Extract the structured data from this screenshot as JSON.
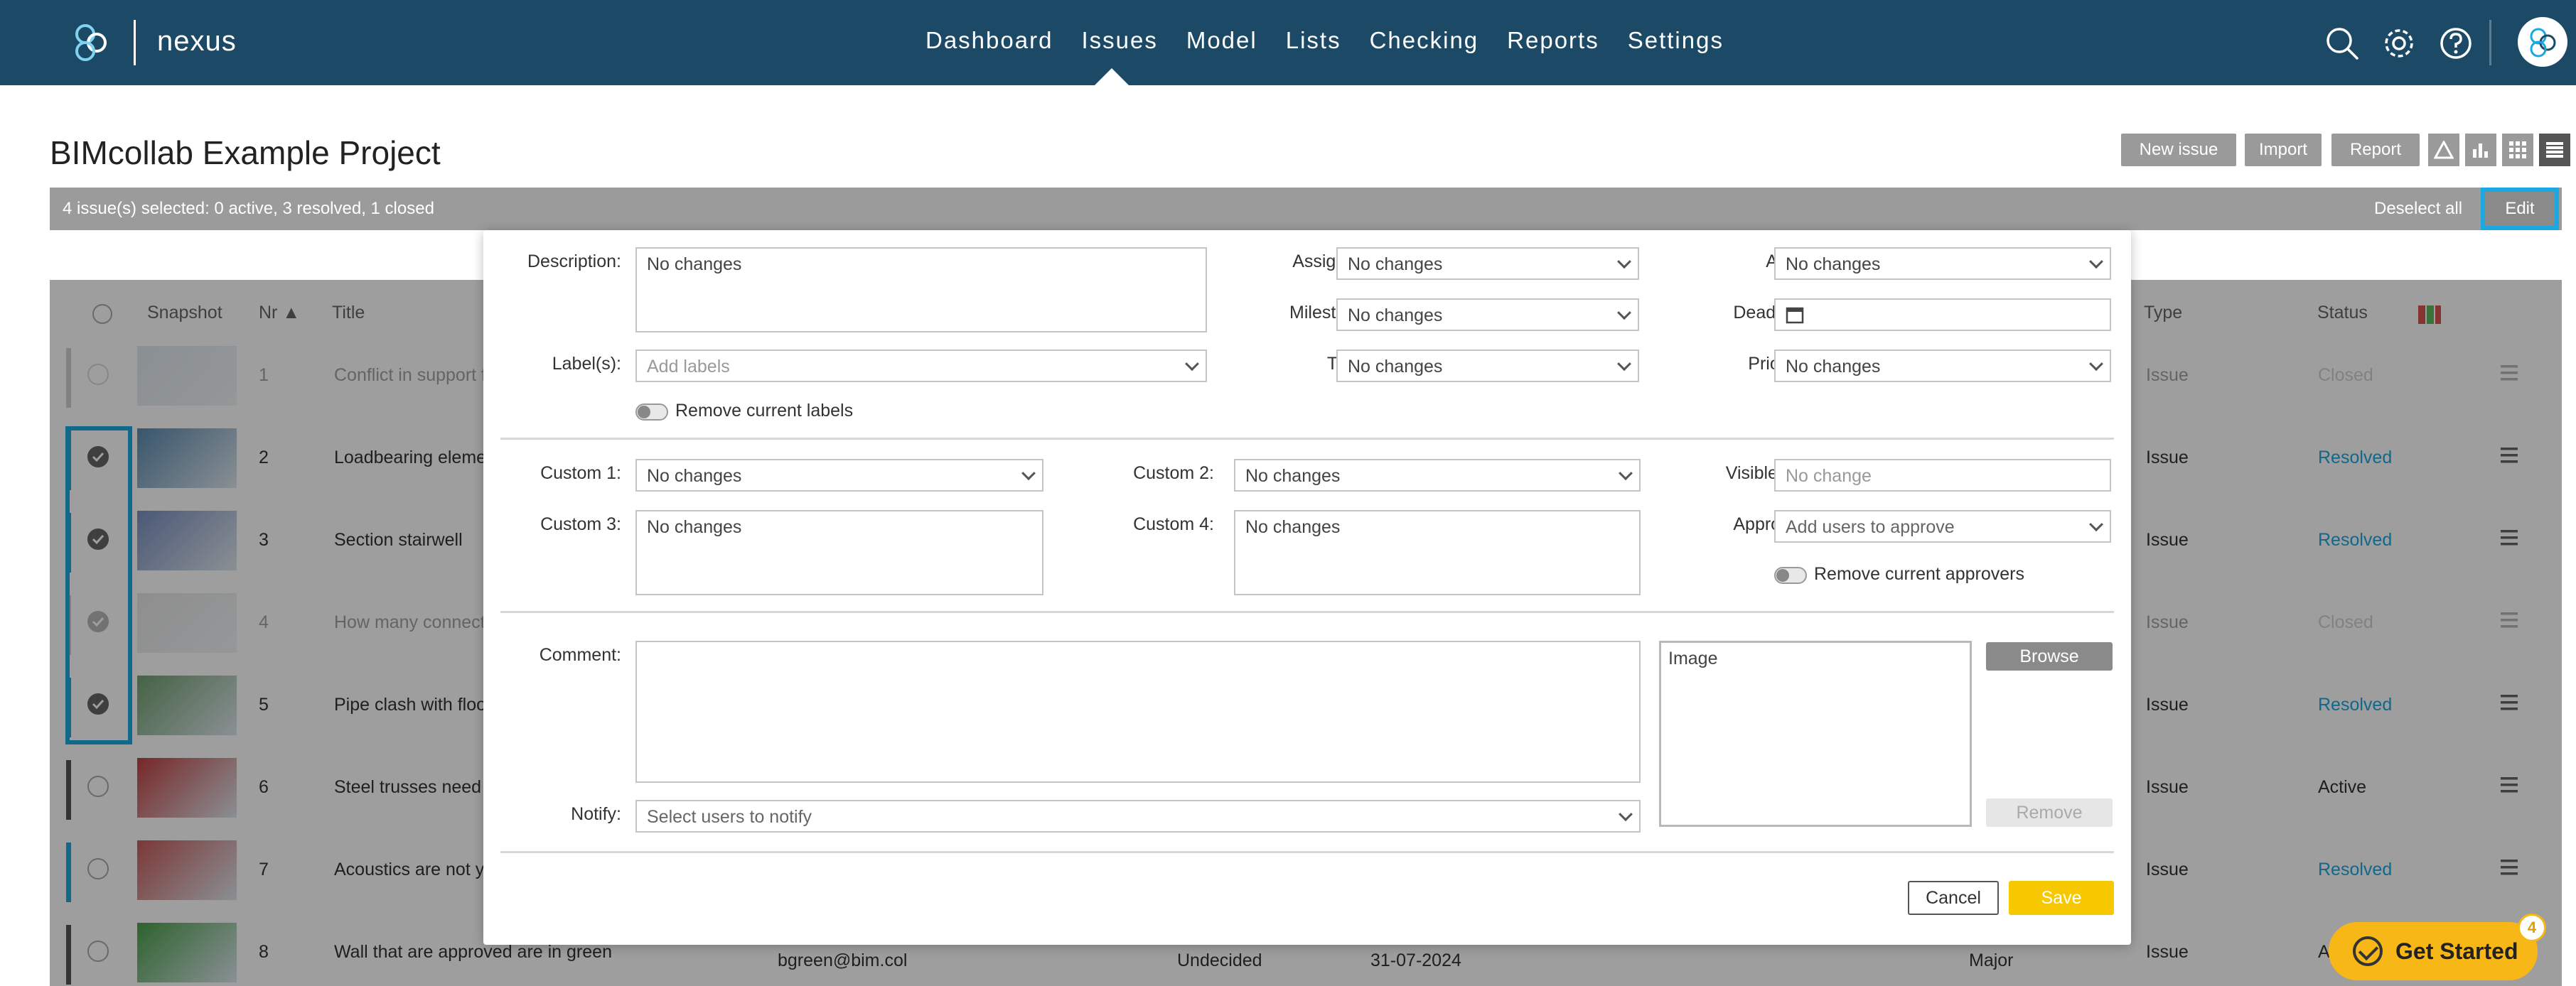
{
  "app": {
    "brand": "nexus"
  },
  "nav": {
    "items": [
      "Dashboard",
      "Issues",
      "Model",
      "Lists",
      "Checking",
      "Reports",
      "Settings"
    ],
    "active": "Issues"
  },
  "header": {
    "project_title": "BIMcollab Example Project",
    "buttons": {
      "new_issue": "New issue",
      "import": "Import",
      "report": "Report"
    }
  },
  "selection": {
    "summary": "4 issue(s) selected: 0 active, 3 resolved, 1 closed",
    "deselect_all": "Deselect all",
    "edit": "Edit"
  },
  "table": {
    "headers": {
      "snapshot": "Snapshot",
      "nr": "Nr ▲",
      "title": "Title",
      "type": "Type",
      "status": "Status"
    },
    "rows": [
      {
        "nr": "1",
        "title": "Conflict in support f",
        "type": "Issue",
        "status": "Closed",
        "checked": false,
        "strip": "#999999",
        "dim": true
      },
      {
        "nr": "2",
        "title": "Loadbearing eleme",
        "type": "Issue",
        "status": "Resolved",
        "checked": true,
        "strip": "#1ba8e0",
        "dim": false
      },
      {
        "nr": "3",
        "title": "Section stairwell",
        "type": "Issue",
        "status": "Resolved",
        "checked": true,
        "strip": "#1ba8e0",
        "dim": false
      },
      {
        "nr": "4",
        "title": "How many connecti",
        "type": "Issue",
        "status": "Closed",
        "checked": true,
        "strip": "#999999",
        "dim": true
      },
      {
        "nr": "5",
        "title": "Pipe clash with floo",
        "type": "Issue",
        "status": "Resolved",
        "checked": true,
        "strip": "#1ba8e0",
        "dim": false
      },
      {
        "nr": "6",
        "title": "Steel trusses need",
        "type": "Issue",
        "status": "Active",
        "checked": false,
        "strip": "#555555",
        "dim": false
      },
      {
        "nr": "7",
        "title": "Acoustics are not yo",
        "type": "Issue",
        "status": "Resolved",
        "checked": false,
        "strip": "#1ba8e0",
        "dim": false
      },
      {
        "nr": "8",
        "title": "Wall that are approved are in green",
        "type": "Issue",
        "status": "A",
        "checked": false,
        "strip": "#555555",
        "dim": false,
        "assigned": "bgreen@bim.col",
        "milestone": "Undecided",
        "deadline": "31-07-2024",
        "priority": "Major"
      }
    ]
  },
  "dialog": {
    "labels": {
      "description": "Description:",
      "labels": "Label(s):",
      "assigned": "Assigned:",
      "milestone": "Milestone:",
      "type": "Type:",
      "area": "Area:",
      "deadline": "Deadline:",
      "priority": "Priority:",
      "custom1": "Custom 1:",
      "custom2": "Custom 2:",
      "custom3": "Custom 3:",
      "custom4": "Custom 4:",
      "visible_for": "Visible for:",
      "approval": "Approval:",
      "comment": "Comment:",
      "notify": "Notify:"
    },
    "values": {
      "description": "No changes",
      "assigned": "No changes",
      "milestone": "No changes",
      "type": "No changes",
      "area": "No changes",
      "priority": "No changes",
      "custom1": "No changes",
      "custom2": "No changes",
      "custom3": "No changes",
      "custom4": "No changes"
    },
    "placeholders": {
      "labels": "Add labels",
      "visible_for": "No change",
      "approval": "Add users to approve",
      "notify": "Select users to notify"
    },
    "toggles": {
      "remove_labels": "Remove current labels",
      "remove_approvers": "Remove current approvers"
    },
    "image": {
      "label": "Image",
      "browse": "Browse",
      "remove": "Remove"
    },
    "buttons": {
      "cancel": "Cancel",
      "save": "Save"
    }
  },
  "get_started": {
    "label": "Get Started",
    "badge": "4"
  },
  "colors": {
    "nav_bg": "#1c4a66",
    "accent_blue": "#1ba8e0",
    "save_yellow": "#f7c800",
    "resolved": "#1ba8e0"
  }
}
